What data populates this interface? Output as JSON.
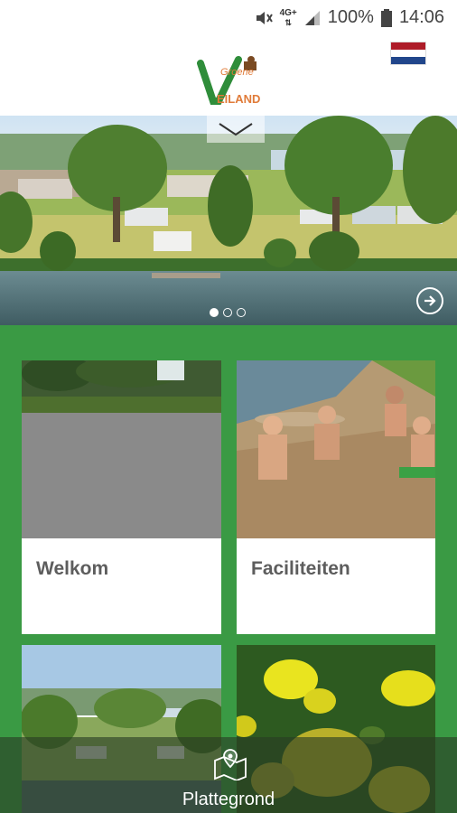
{
  "status_bar": {
    "network": "4G+",
    "battery": "100%",
    "time": "14:06",
    "icons": [
      "mute-icon",
      "network-icon",
      "signal-icon",
      "battery-icon"
    ]
  },
  "header": {
    "logo": {
      "line1": "Groene",
      "letter": "Y",
      "line2": "EILAND"
    },
    "language_flag": "dutch-flag"
  },
  "hero": {
    "chevron": "chevron-down-icon",
    "dots": [
      true,
      false,
      false
    ],
    "next": "arrow-right-circle-icon"
  },
  "cards": [
    {
      "title": "Welkom"
    },
    {
      "title": "Faciliteiten"
    },
    {
      "title": ""
    },
    {
      "title": ""
    }
  ],
  "bottom_bar": {
    "label": "Plattegrond",
    "icon": "map-pin-icon"
  },
  "colors": {
    "brand_green": "#3a9a44",
    "logo_orange": "#e07b39",
    "card_text": "#5d5d5d"
  }
}
